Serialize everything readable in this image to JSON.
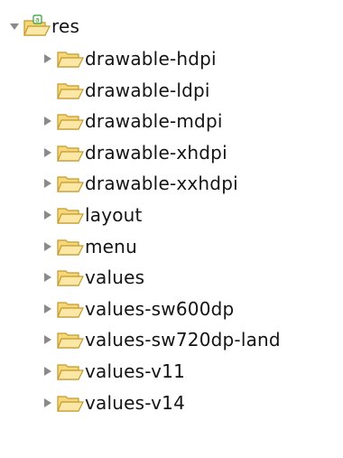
{
  "tree": {
    "root": {
      "label": "res",
      "expanded": true,
      "icon": "resource-folder-icon",
      "badge_color": "#2f9e2f"
    },
    "items": [
      {
        "label": "drawable-hdpi",
        "expandable": true
      },
      {
        "label": "drawable-ldpi",
        "expandable": false
      },
      {
        "label": "drawable-mdpi",
        "expandable": true
      },
      {
        "label": "drawable-xhdpi",
        "expandable": true
      },
      {
        "label": "drawable-xxhdpi",
        "expandable": true
      },
      {
        "label": "layout",
        "expandable": true
      },
      {
        "label": "menu",
        "expandable": true
      },
      {
        "label": "values",
        "expandable": true
      },
      {
        "label": "values-sw600dp",
        "expandable": true
      },
      {
        "label": "values-sw720dp-land",
        "expandable": true
      },
      {
        "label": "values-v11",
        "expandable": true
      },
      {
        "label": "values-v14",
        "expandable": true
      }
    ],
    "colors": {
      "folder_fill": "#f6d77a",
      "folder_stroke": "#c49a2c",
      "twisty": "#8a8a8a"
    }
  }
}
